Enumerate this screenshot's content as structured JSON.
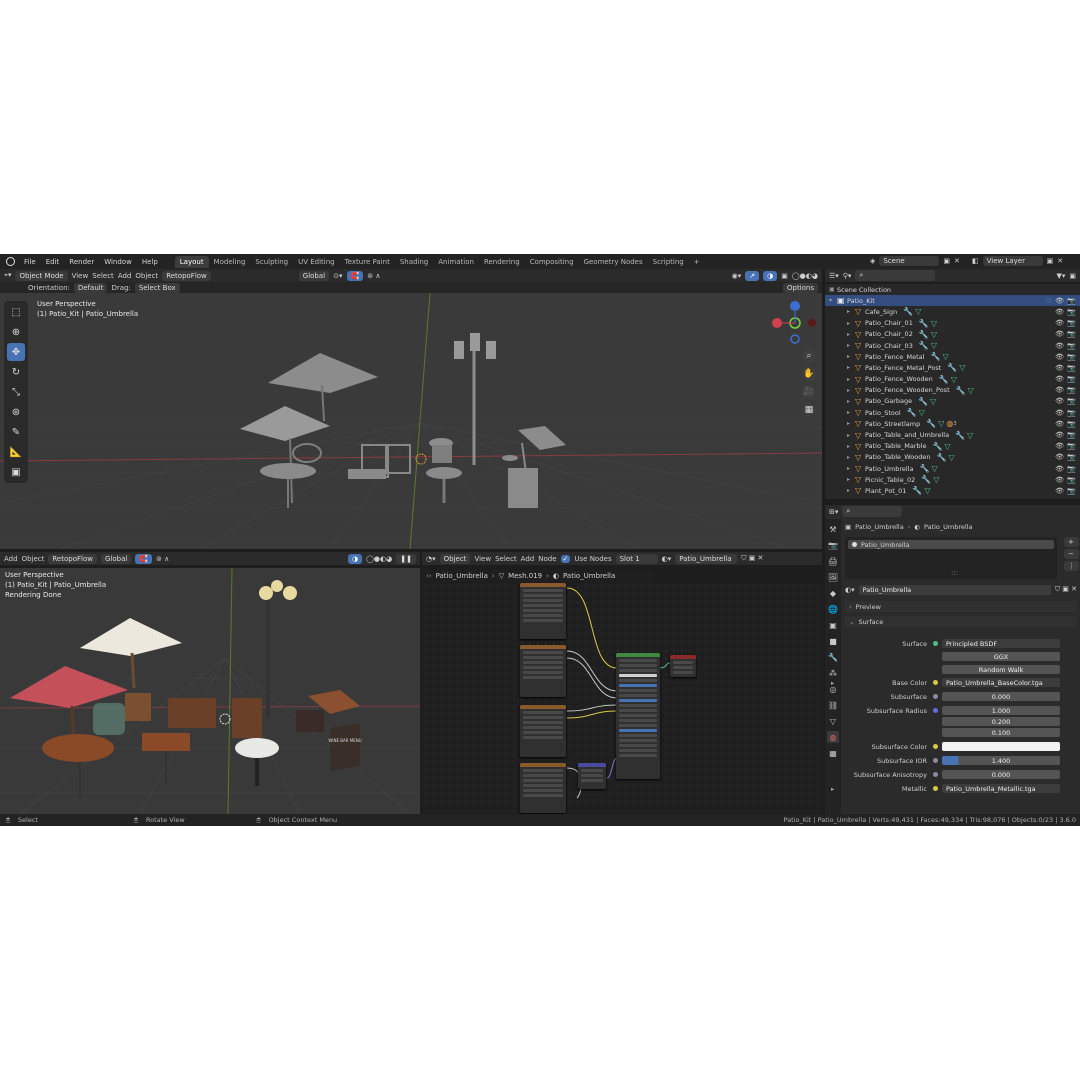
{
  "topbar": {
    "menus": [
      "File",
      "Edit",
      "Render",
      "Window",
      "Help"
    ],
    "workspaces": [
      "Layout",
      "Modeling",
      "Sculpting",
      "UV Editing",
      "Texture Paint",
      "Shading",
      "Animation",
      "Rendering",
      "Compositing",
      "Geometry Nodes",
      "Scripting"
    ],
    "active_workspace": "Layout",
    "add_tab": "+",
    "scene": "Scene",
    "view_layer": "View Layer"
  },
  "main_viewport": {
    "mode": "Object Mode",
    "menus": [
      "View",
      "Select",
      "Add",
      "Object"
    ],
    "addon": "RetopoFlow",
    "transform": "Global",
    "orientation_label": "Orientation:",
    "orientation_value": "Default",
    "drag_label": "Drag:",
    "drag_value": "Select Box",
    "options": "Options",
    "overlay_line1": "User Perspective",
    "overlay_line2": "(1) Patio_Kit | Patio_Umbrella"
  },
  "render_viewport": {
    "menus": [
      "Add",
      "Object"
    ],
    "addon": "RetopoFlow",
    "transform": "Global",
    "overlay_line1": "User Perspective",
    "overlay_line2": "(1) Patio_Kit | Patio_Umbrella",
    "overlay_line3": "Rendering Done",
    "menu_card": "WINE BAR MENU"
  },
  "node_editor": {
    "type": "Object",
    "menus": [
      "View",
      "Select",
      "Add",
      "Node"
    ],
    "use_nodes": "Use Nodes",
    "slot": "Slot 1",
    "material": "Patio_Umbrella",
    "breadcrumb": [
      "Patio_Umbrella",
      "Mesh.019",
      "Patio_Umbrella"
    ]
  },
  "outliner": {
    "root": "Scene Collection",
    "collection": "Patio_Kit",
    "items": [
      "Cafe_Sign",
      "Patio_Chair_01",
      "Patio_Chair_02",
      "Patio_Chair_03",
      "Patio_Fence_Metal",
      "Patio_Fence_Metal_Post",
      "Patio_Fence_Wooden",
      "Patio_Fence_Wooden_Post",
      "Patio_Garbage",
      "Patio_Stool",
      "Patio_Streetlamp",
      "Patio_Table_and_Umbrella",
      "Patio_Table_Marble",
      "Patio_Table_Wooden",
      "Patio_Umbrella",
      "Picnic_Table_02",
      "Plant_Pot_01"
    ],
    "streetlamp_count": "3"
  },
  "properties": {
    "breadcrumb_obj": "Patio_Umbrella",
    "breadcrumb_mat": "Patio_Umbrella",
    "slot_item": "Patio_Umbrella",
    "slot_add": "+",
    "slot_remove": "−",
    "slot_menu": "⋮",
    "material_name": "Patio_Umbrella",
    "preview": "Preview",
    "surface_header": "Surface",
    "rows": [
      {
        "label": "Surface",
        "value": "Principled BSDF"
      },
      {
        "label": "",
        "value": "GGX"
      },
      {
        "label": "",
        "value": "Random Walk"
      },
      {
        "label": "Base Color",
        "value": "Patio_Umbrella_BaseColor.tga"
      },
      {
        "label": "Subsurface",
        "value": "0.000"
      },
      {
        "label": "Subsurface Radius",
        "value": "1.000"
      },
      {
        "label": "",
        "value": "0.200"
      },
      {
        "label": "",
        "value": "0.100"
      },
      {
        "label": "Subsurface Color",
        "value": ""
      },
      {
        "label": "Subsurface IOR",
        "value": "1.400"
      },
      {
        "label": "Subsurface Anisotropy",
        "value": "0.000"
      },
      {
        "label": "Metallic",
        "value": "Patio_Umbrella_Metallic.tga"
      }
    ]
  },
  "statusbar": {
    "select": "Select",
    "rotate": "Rotate View",
    "context": "Object Context Menu",
    "stats": "Patio_Kit | Patio_Umbrella | Verts:49,431 | Faces:49,334 | Tris:98,076 | Objects:0/23 | 3.6.0"
  },
  "colors": {
    "accent": "#4772b3",
    "object_icon": "#e8a048",
    "material_icon": "#4fc08c",
    "umbrella_red": "#c4505a",
    "umbrella_white": "#ece8dd"
  }
}
